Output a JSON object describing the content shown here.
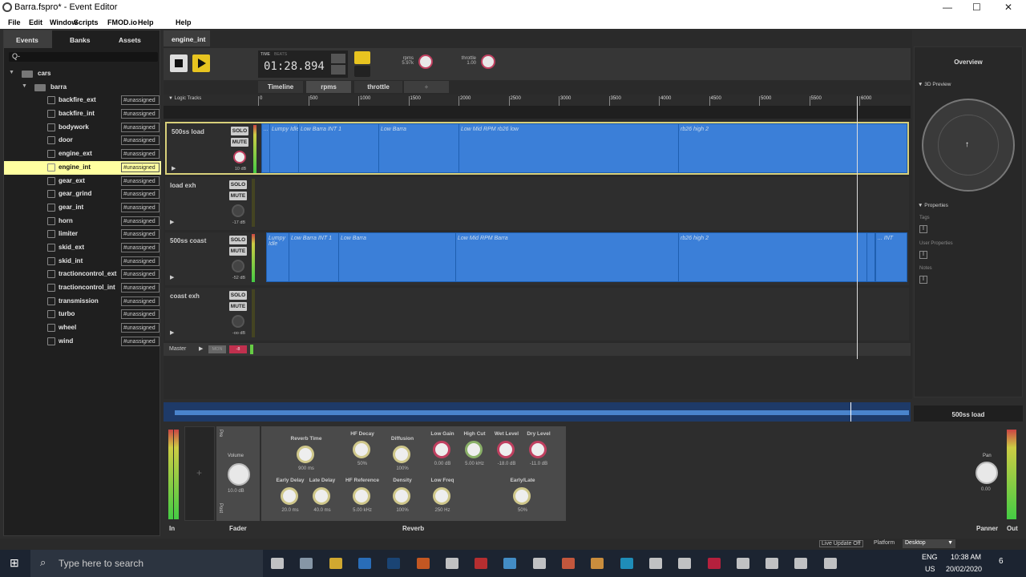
{
  "window": {
    "title": "Barra.fspro* - Event Editor",
    "min": "—",
    "max": "☐",
    "close": "✕"
  },
  "menu": [
    "File",
    "Edit",
    "Window",
    "Scripts",
    "FMOD.io",
    "Help"
  ],
  "left_tabs": [
    "Events",
    "Banks",
    "Assets"
  ],
  "search": {
    "placeholder": "Q-"
  },
  "tree": {
    "root": "cars",
    "folder": "barra",
    "tag": "#unassigned",
    "events": [
      "backfire_ext",
      "backfire_int",
      "bodywork",
      "door",
      "engine_ext",
      "engine_int",
      "gear_ext",
      "gear_grind",
      "gear_int",
      "horn",
      "limiter",
      "skid_ext",
      "skid_int",
      "tractioncontrol_ext",
      "tractioncontrol_int",
      "transmission",
      "turbo",
      "wheel",
      "wind"
    ],
    "selected": "engine_int"
  },
  "editor": {
    "tab": "engine_int",
    "time_mode": "TIME",
    "beats": "BEATS",
    "time": "01:28.894",
    "params": [
      {
        "name": "rpms",
        "value": "5.97k"
      },
      {
        "name": "throttle",
        "value": "1.00"
      }
    ],
    "tabs": [
      "Timeline",
      "rpms",
      "throttle",
      "+"
    ],
    "logic_tracks": "Logic Tracks",
    "ruler": [
      "0",
      "500",
      "1000",
      "1500",
      "2000",
      "2500",
      "3000",
      "3500",
      "4000",
      "4500",
      "5000",
      "5500",
      "6000"
    ],
    "tracks": [
      {
        "name": "500ss load",
        "solo": "SOLO",
        "mute": "MUTE",
        "db": "10 dB",
        "regions": [
          "...",
          "Lumpy Idle",
          "Low Barra INT 1",
          "Low Barra",
          "Low Mid RPM rb26 low",
          "rb26 high 2"
        ]
      },
      {
        "name": "load exh",
        "solo": "SOLO",
        "mute": "MUTE",
        "db": "-17 dB",
        "regions": []
      },
      {
        "name": "500ss coast",
        "solo": "SOLO",
        "mute": "MUTE",
        "db": "-52 dB",
        "regions": [
          "Lumpy Idle",
          "Low Barra INT 1",
          "Low Barra",
          "Low Mid RPM Barra",
          "rb26 high 2",
          "... INT"
        ]
      },
      {
        "name": "coast exh",
        "solo": "SOLO",
        "mute": "MUTE",
        "db": "-oo dB",
        "regions": []
      }
    ],
    "master": {
      "name": "Master",
      "mon": "MON",
      "rec": "-8"
    }
  },
  "overview": {
    "title": "Overview",
    "preview": "3D Preview",
    "properties": "Properties",
    "tags": "Tags",
    "user_props": "User Properties",
    "notes": "Notes"
  },
  "deck": {
    "track": "500ss load",
    "pre": "Pre",
    "post": "Post",
    "volume": "Volume",
    "vol_val": "10.0 dB",
    "reverb": [
      {
        "l": "Reverb Time",
        "v": "900 ms"
      },
      {
        "l": "HF Decay",
        "v": "50%"
      },
      {
        "l": "Diffusion",
        "v": "100%"
      },
      {
        "l": "Low Gain",
        "v": "0.00 dB"
      },
      {
        "l": "High Cut",
        "v": "5.00 kHz"
      },
      {
        "l": "Wet Level",
        "v": "-18.0 dB"
      },
      {
        "l": "Dry Level",
        "v": "-11.0 dB"
      },
      {
        "l": "Early Delay",
        "v": "20.0 ms"
      },
      {
        "l": "Late Delay",
        "v": "40.0 ms"
      },
      {
        "l": "HF Reference",
        "v": "5.00 kHz"
      },
      {
        "l": "Density",
        "v": "100%"
      },
      {
        "l": "Low Freq",
        "v": "250 Hz"
      },
      {
        "l": "Early/Late",
        "v": "50%"
      }
    ],
    "in": "In",
    "fader": "Fader",
    "reverb_label": "Reverb",
    "panner": "Panner",
    "out": "Out",
    "pan": "Pan",
    "pan_val": "0.00"
  },
  "status": {
    "live": "Live Update Off",
    "platform": "Platform",
    "desktop": "Desktop"
  },
  "taskbar": {
    "search": "Type here to search",
    "lang1": "ENG",
    "lang2": "US",
    "time": "10:38 AM",
    "date": "20/02/2020",
    "notif": "6"
  }
}
